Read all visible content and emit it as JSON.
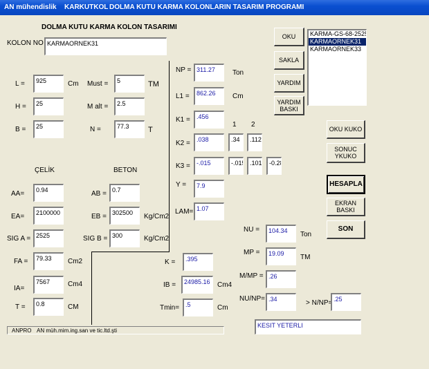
{
  "titlebar": {
    "app": "AN mühendislik",
    "menu1": "KARKUTKOL",
    "title": "DOLMA KUTU KARMA KOLONLARIN  TASARIM  PROGRAMI"
  },
  "form": {
    "heading": "DOLMA KUTU KARMA KOLON TASARIMI",
    "kolon_no_label": "KOLON NO",
    "kolon_no_value": "KARMAORNEK31"
  },
  "inputs": {
    "L": {
      "label": "L =",
      "value": "925",
      "unit": "Cm"
    },
    "H": {
      "label": "H =",
      "value": "25"
    },
    "B": {
      "label": "B =",
      "value": "25"
    },
    "Must": {
      "label": "Must =",
      "value": "5",
      "unit": "TM"
    },
    "Malt": {
      "label": "M alt =",
      "value": "2.5"
    },
    "N": {
      "label": "N =",
      "value": "77.3",
      "unit": "T"
    }
  },
  "materials": {
    "celik_heading": "ÇELİK",
    "beton_heading": "BETON",
    "AA": {
      "label": "AA=",
      "value": "0.94"
    },
    "EA": {
      "label": "EA=",
      "value": "2100000"
    },
    "SIGA": {
      "label": "SIG A =",
      "value": "2525"
    },
    "AB": {
      "label": "AB =",
      "value": "0.7"
    },
    "EB": {
      "label": "EB =",
      "value": "302500",
      "unit": "Kg/Cm2"
    },
    "SIGB": {
      "label": "SIG B =",
      "value": "300",
      "unit": "Kg/Cm2"
    }
  },
  "section": {
    "FA": {
      "label": "FA =",
      "value": "79.33",
      "unit": "Cm2"
    },
    "IA": {
      "label": "IA=",
      "value": "7567",
      "unit": "Cm4"
    },
    "T": {
      "label": "T =",
      "value": "0.8",
      "unit": "CM"
    }
  },
  "results_mid": {
    "NP": {
      "label": "NP =",
      "value": "311.27",
      "unit": "Ton"
    },
    "L1": {
      "label": "L1 =",
      "value": "862.26",
      "unit": "Cm"
    },
    "K1": {
      "label": "K1 =",
      "value": ".456"
    },
    "col1": "1",
    "col2": "2",
    "K2": {
      "label": "K2 =",
      "v1": ".038",
      "v2": ".34",
      "v3": ".112"
    },
    "K3": {
      "label": "K3 =",
      "v1": "-.015",
      "v2": "-.015",
      "v3": ".101",
      "v4": "-0.28"
    },
    "Y": {
      "label": "Y =",
      "value": "7.9"
    },
    "LAM": {
      "label": "LAM=",
      "value": "1.07"
    },
    "K": {
      "label": "K =",
      "value": ".395"
    },
    "IB": {
      "label": "IB =",
      "value": "24985.16",
      "unit": "Cm4"
    },
    "Tmin": {
      "label": "Tmin=",
      "value": ".5",
      "unit": "Cm"
    }
  },
  "results_right": {
    "NU": {
      "label": "NU =",
      "value": "104.34",
      "unit": "Ton"
    },
    "MP": {
      "label": "MP =",
      "value": "19.09",
      "unit": "TM"
    },
    "MMP": {
      "label": "M/MP =",
      "value": ".26"
    },
    "NUNP": {
      "label": "NU/NP=",
      "value": ".34"
    },
    "NNP": {
      "label": "> N/NP=",
      "value": ".25"
    },
    "status": "KESIT YETERLI"
  },
  "buttons": {
    "oku": "OKU",
    "sakla": "SAKLA",
    "yardim": "YARDIM",
    "yardim_baski": "YARDIM\nBASKI",
    "oku_kuko": "OKU KUKO",
    "sonuc_ykuko": "SONUC\nYKUKO",
    "hesapla": "HESAPLA",
    "ekran_baski": "EKRAN BASKI",
    "son": "SON"
  },
  "listbox": {
    "items": [
      "KARMA-GS-68-2525",
      "KARMAORNEK31",
      "KARMAORNEK33"
    ],
    "selected_index": 1
  },
  "statusbar": {
    "left": "ANPRO",
    "right": "AN müh.mim.ing.san ve tic.ltd.şti"
  }
}
